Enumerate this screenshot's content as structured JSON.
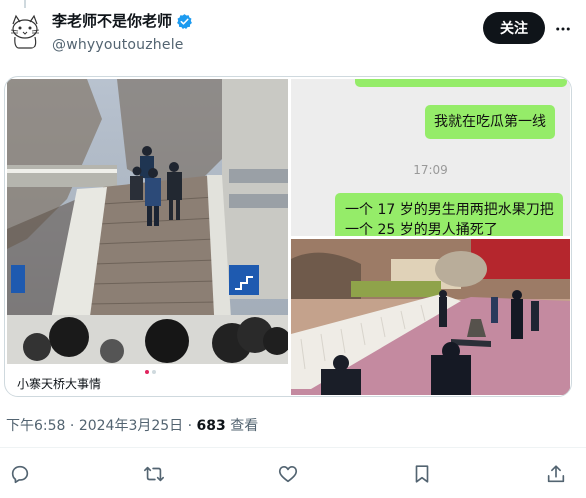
{
  "author": {
    "display_name": "李老师不是你老师",
    "handle": "@whyyoutouzhele",
    "verified": true
  },
  "header": {
    "follow_label": "关注",
    "more_icon": "more-horizontal-icon"
  },
  "media": {
    "slide_caption": "小寨天桥大事情",
    "carousel_dots": 2,
    "active_dot": 0,
    "chat": {
      "messages": [
        {
          "text": "我就在吃瓜第一线"
        },
        {
          "text": "一个 17 岁的男生用两把水果刀把一个 25 岁的男人捅死了"
        }
      ],
      "timestamp": "17:09"
    }
  },
  "meta": {
    "time": "下午6:58",
    "separator": " · ",
    "date": "2024年3月25日",
    "views_count": "683",
    "views_label": " 查看"
  },
  "actions": [
    {
      "name": "reply",
      "icon": "reply-icon"
    },
    {
      "name": "repost",
      "icon": "repost-icon"
    },
    {
      "name": "like",
      "icon": "like-icon"
    },
    {
      "name": "bookmark",
      "icon": "bookmark-icon"
    },
    {
      "name": "share",
      "icon": "share-icon"
    }
  ],
  "colors": {
    "accent_dark": "#0f1419",
    "secondary_text": "#536471",
    "verified_blue": "#1d9bf0",
    "wechat_green": "#95ec69",
    "chat_background": "#ededed"
  }
}
